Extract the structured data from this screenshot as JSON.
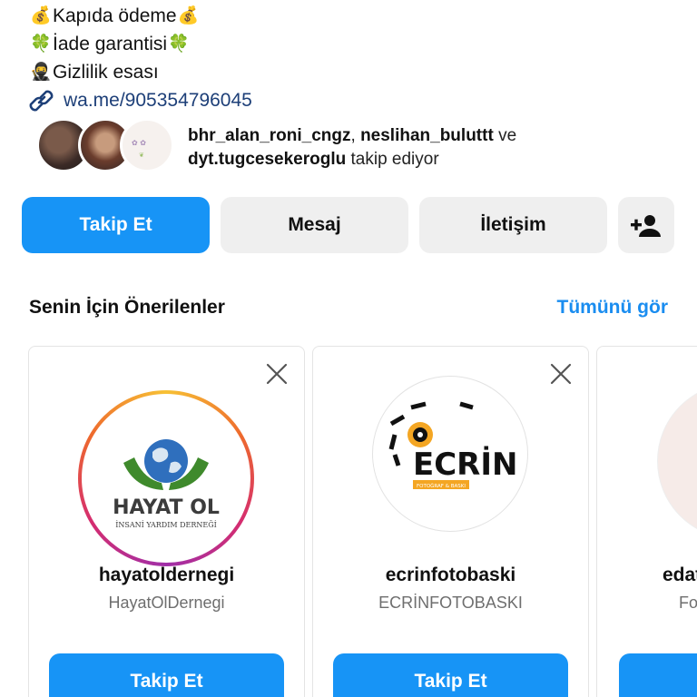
{
  "bio": {
    "line1": "Kapıda ödeme",
    "line2": "İade garantisi",
    "line3": "Gizlilik esası",
    "link": "wa.me/905354796045",
    "icons": {
      "money": "💰",
      "clover": "🍀",
      "ninja": "🥷"
    }
  },
  "followers": {
    "user1": "bhr_alan_roni_cngz",
    "sep": ", ",
    "user2": "neslihan_buluttt",
    "and": " ve",
    "user3": "dyt.tugcesekeroglu",
    "suffix": " takip ediyor"
  },
  "actions": {
    "follow": "Takip Et",
    "message": "Mesaj",
    "contact": "İletişim"
  },
  "suggestions": {
    "title": "Senin İçin Önerilenler",
    "see_all": "Tümünü gör",
    "cards": [
      {
        "username": "hayatoldernegi",
        "fullname": "HayatOlDernegi",
        "button": "Takip Et",
        "logo_main": "HAYAT OL",
        "logo_sub": "İNSANİ YARDIM DERNEĞİ"
      },
      {
        "username": "ecrinfotobaski",
        "fullname": "ECRİNFOTOBASKI",
        "button": "Takip Et",
        "logo_main": "ECRİN",
        "logo_sub": "FOTOĞRAF & BASKI"
      },
      {
        "username": "edat",
        "fullname": "Fo",
        "button": ""
      }
    ]
  },
  "colors": {
    "primary": "#1794f6",
    "link": "#1d3f78",
    "see_all": "#1a8df0",
    "secondary_bg": "#efefef"
  }
}
